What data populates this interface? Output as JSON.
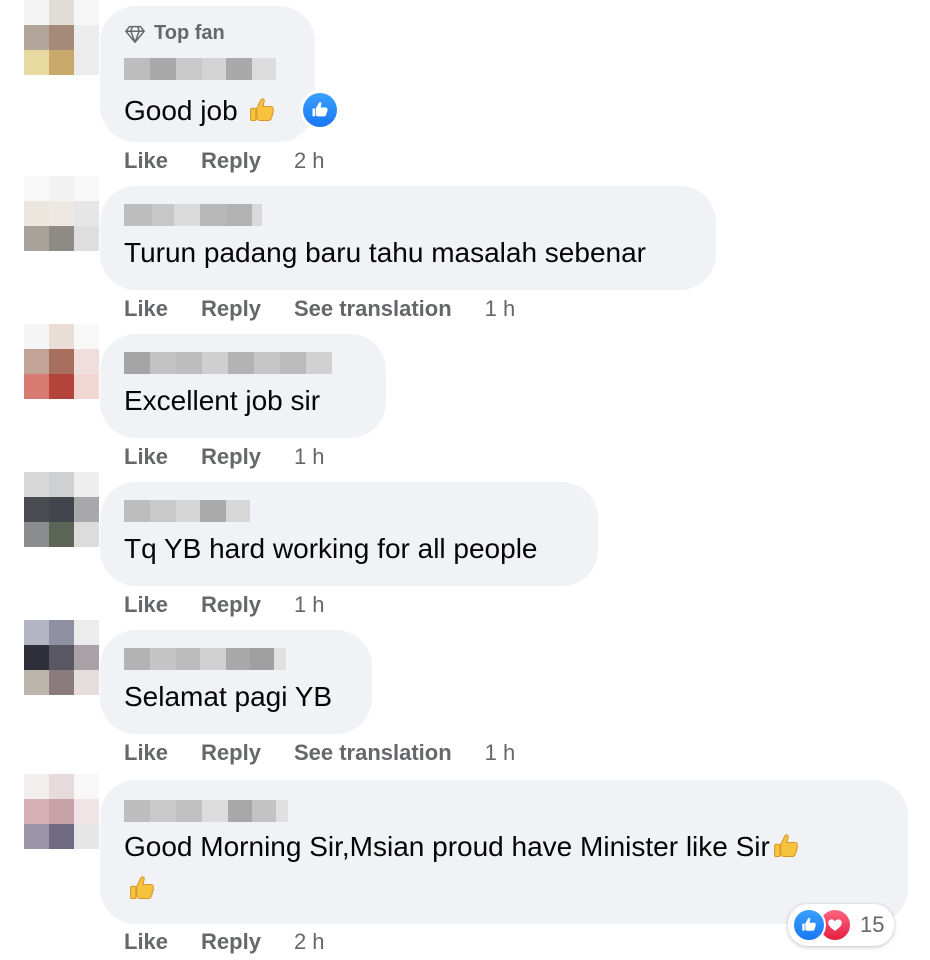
{
  "colors": {
    "bubble": "#f0f2f5",
    "meta_text": "#65676b",
    "like_blue": "#1877f2",
    "love_red": "#e41e3f"
  },
  "comments": [
    {
      "badge": "Top fan",
      "badge_icon": "diamond-icon",
      "text": "Good job",
      "trailing_emoji": "thumbs-up-emoji",
      "has_like_reaction": true,
      "actions": [
        "Like",
        "Reply"
      ],
      "time": "2 h"
    },
    {
      "text": "Turun padang baru tahu masalah sebenar",
      "actions": [
        "Like",
        "Reply",
        "See translation"
      ],
      "time": "1 h"
    },
    {
      "text": "Excellent job sir",
      "actions": [
        "Like",
        "Reply"
      ],
      "time": "1 h"
    },
    {
      "text": "Tq YB hard working for all people",
      "actions": [
        "Like",
        "Reply"
      ],
      "time": "1 h"
    },
    {
      "text": "Selamat pagi YB",
      "actions": [
        "Like",
        "Reply",
        "See translation"
      ],
      "time": "1 h"
    },
    {
      "text": "Good Morning Sir,Msian proud have Minister like Sir",
      "trailing_emoji": "thumbs-up-emoji",
      "second_line_emoji": "thumbs-up-emoji",
      "actions": [
        "Like",
        "Reply"
      ],
      "time": "2 h",
      "reactions": {
        "types": [
          "like",
          "love"
        ],
        "count": "15"
      }
    }
  ]
}
